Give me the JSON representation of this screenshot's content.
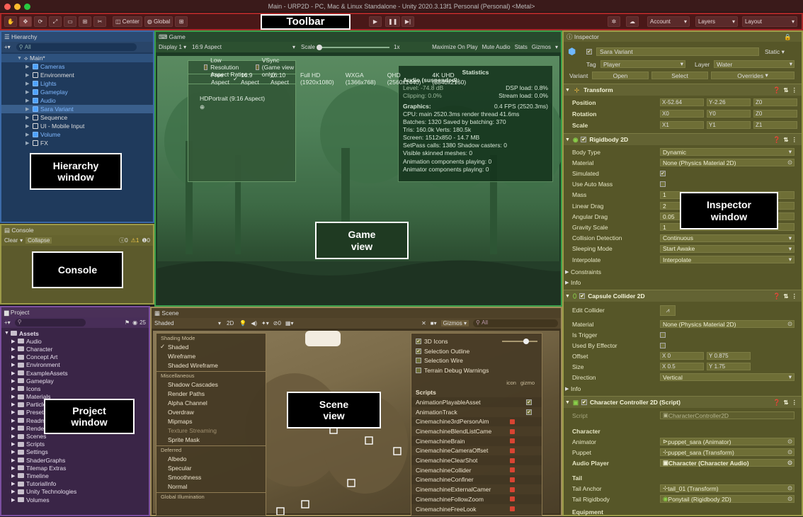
{
  "window": {
    "title": "Main - URP2D - PC, Mac & Linux Standalone - Unity 2020.3.13f1 Personal (Personal) <Metal>"
  },
  "toolbar": {
    "callout": "Toolbar",
    "center_label": "Center",
    "global_label": "Global",
    "account": "Account",
    "layers": "Layers",
    "layout": "Layout"
  },
  "hierarchy": {
    "tab": "Hierarchy",
    "search_placeholder": "All",
    "callout_line1": "Hierarchy",
    "callout_line2": "window",
    "scene_name": "Main*",
    "items": [
      {
        "label": "Cameras",
        "color": "#7fb8ff"
      },
      {
        "label": "Environment",
        "color": "#dddddd"
      },
      {
        "label": "Lights",
        "color": "#7fb8ff"
      },
      {
        "label": "Gameplay",
        "color": "#7fb8ff"
      },
      {
        "label": "Audio",
        "color": "#7fb8ff"
      },
      {
        "label": "Sara Variant",
        "color": "#7fb8ff"
      },
      {
        "label": "Sequence",
        "color": "#dddddd"
      },
      {
        "label": "UI - Mobile Input",
        "color": "#dddddd"
      },
      {
        "label": "Volume",
        "color": "#7fb8ff"
      },
      {
        "label": "FX",
        "color": "#dddddd"
      }
    ]
  },
  "console": {
    "tab": "Console",
    "clear": "Clear",
    "collapse": "Collapse",
    "count_log": "0",
    "count_warn": "1",
    "count_err": "0",
    "callout": "Console"
  },
  "project": {
    "tab": "Project",
    "count": "25",
    "callout_line1": "Project",
    "callout_line2": "window",
    "root": "Assets",
    "items": [
      "Audio",
      "Character",
      "Concept Art",
      "Environment",
      "ExampleAssets",
      "Gameplay",
      "Icons",
      "Materials",
      "ParticleSystems",
      "Presets",
      "Readme",
      "RenderPipeline",
      "Scenes",
      "Scripts",
      "Settings",
      "ShaderGraphs",
      "Tilemap Extras",
      "Timeline",
      "TutorialInfo",
      "Unity Technologies",
      "Volumes"
    ]
  },
  "game": {
    "tab": "Game",
    "display": "Display 1",
    "aspect": "16:9 Aspect",
    "scale_label": "Scale",
    "scale_value": "1x",
    "buttons": [
      "Maximize On Play",
      "Mute Audio",
      "Stats",
      "Gizmos"
    ],
    "callout_line1": "Game",
    "callout_line2": "view",
    "aspect_menu": {
      "checks": [
        "Low Resolution Aspect Ratios",
        "VSync (Game view only)"
      ],
      "options": [
        "Free Aspect",
        "16:9 Aspect",
        "16:10 Aspect",
        "Full HD (1920x1080)",
        "WXGA (1366x768)",
        "QHD (2560x1440)",
        "4K UHD (3840x2160)"
      ],
      "selected": "16:9 Aspect",
      "custom": "HDPortrait (9:16 Aspect)"
    },
    "stats": {
      "title": "Statistics",
      "audio_header": "Audio (suspended):",
      "level": "Level: -74.8 dB",
      "clipping": "Clipping: 0.0%",
      "dsp": "DSP load: 0.8%",
      "stream": "Stream load: 0.0%",
      "graphics_header": "Graphics:",
      "fps": "0.4 FPS (2520.3ms)",
      "lines": [
        "CPU: main 2520.3ms  render thread 41.6ms",
        "Batches: 1320  Saved by batching: 370",
        "Tris: 160.0k     Verts: 180.5k",
        "Screen: 1512x850 - 14.7 MB",
        "SetPass calls: 1380    Shadow casters: 0",
        "Visible skinned meshes: 0",
        "Animation components playing: 0",
        "Animator components playing: 0"
      ]
    }
  },
  "scene": {
    "tab": "Scene",
    "shading": "Shaded",
    "mode_2d": "2D",
    "hidden_count": "0",
    "gizmos": "Gizmos",
    "search_placeholder": "All",
    "callout_line1": "Scene",
    "callout_line2": "view",
    "shading_menu": {
      "sections": [
        {
          "header": "Shading Mode",
          "items": [
            "Shaded",
            "Wireframe",
            "Shaded Wireframe"
          ]
        },
        {
          "header": "Miscellaneous",
          "items": [
            "Shadow Cascades",
            "Render Paths",
            "Alpha Channel",
            "Overdraw",
            "Mipmaps",
            "Texture Streaming",
            "Sprite Mask"
          ]
        },
        {
          "header": "Deferred",
          "items": [
            "Albedo",
            "Specular",
            "Smoothness",
            "Normal"
          ]
        },
        {
          "header": "Global Illumination",
          "items": []
        }
      ],
      "selected": "Shaded"
    },
    "gizmo_menu": {
      "toggles": [
        "3D Icons",
        "Selection Outline",
        "Selection Wire",
        "Terrain Debug Warnings"
      ],
      "col_icon": "icon",
      "col_gizmo": "gizmo",
      "scripts_header": "Scripts",
      "scripts": [
        "AnimationPlayableAsset",
        "AnimationTrack",
        "Cinemachine3rdPersonAim",
        "CinemachineBlendListCame",
        "CinemachineBrain",
        "CinemachineCameraOffset",
        "CinemachineClearShot",
        "CinemachineCollider",
        "CinemachineConfiner",
        "CinemachineExternalCamer",
        "CinemachineFollowZoom",
        "CinemachineFreeLook"
      ]
    }
  },
  "inspector": {
    "tab": "Inspector",
    "object_name": "Sara Variant",
    "static_label": "Static",
    "tag_label": "Tag",
    "tag": "Player",
    "layer_label": "Layer",
    "layer": "Water",
    "variant_label": "Variant",
    "open": "Open",
    "select": "Select",
    "overrides": "Overrides",
    "callout_line1": "Inspector",
    "callout_line2": "window",
    "transform": {
      "title": "Transform",
      "position": {
        "label": "Position",
        "x": "-52.64",
        "y": "-2.26",
        "z": "0"
      },
      "rotation": {
        "label": "Rotation",
        "x": "0",
        "y": "0",
        "z": "0"
      },
      "scale": {
        "label": "Scale",
        "x": "1",
        "y": "1",
        "z": "1"
      }
    },
    "rigidbody": {
      "title": "Rigidbody 2D",
      "fields": [
        {
          "label": "Body Type",
          "value": "Dynamic",
          "dd": true
        },
        {
          "label": "Material",
          "value": "None (Physics Material 2D)"
        },
        {
          "label": "Simulated",
          "value": "✔"
        },
        {
          "label": "Use Auto Mass",
          "value": ""
        },
        {
          "label": "Mass",
          "value": "1"
        },
        {
          "label": "Linear Drag",
          "value": "2"
        },
        {
          "label": "Angular Drag",
          "value": "0.05"
        },
        {
          "label": "Gravity Scale",
          "value": "1"
        },
        {
          "label": "Collision Detection",
          "value": "Continuous",
          "dd": true
        },
        {
          "label": "Sleeping Mode",
          "value": "Start Awake",
          "dd": true
        },
        {
          "label": "Interpolate",
          "value": "Interpolate",
          "dd": true
        }
      ],
      "foldouts": [
        "Constraints",
        "Info"
      ]
    },
    "capsule": {
      "title": "Capsule Collider 2D",
      "edit_collider": "Edit Collider",
      "material_label": "Material",
      "material": "None (Physics Material 2D)",
      "is_trigger": "Is Trigger",
      "used_by_effector": "Used By Effector",
      "offset_label": "Offset",
      "offset_x": "0",
      "offset_y": "0.875",
      "size_label": "Size",
      "size_x": "0.5",
      "size_y": "1.75",
      "direction_label": "Direction",
      "direction": "Vertical",
      "info": "Info"
    },
    "controller": {
      "title": "Character Controller 2D (Script)",
      "script_label": "Script",
      "script": "CharacterController2D",
      "character_header": "Character",
      "animator_label": "Animator",
      "animator": "puppet_sara (Animator)",
      "puppet_label": "Puppet",
      "puppet": "puppet_sara (Transform)",
      "audio_label": "Audio Player",
      "audio": "Character (Character Audio)",
      "tail_header": "Tail",
      "tail_anchor_label": "Tail Anchor",
      "tail_anchor": "tail_01 (Transform)",
      "tail_rb_label": "Tail Rigidbody",
      "tail_rb": "Ponytail (Rigidbody 2D)",
      "equipment_header": "Equipment"
    }
  }
}
